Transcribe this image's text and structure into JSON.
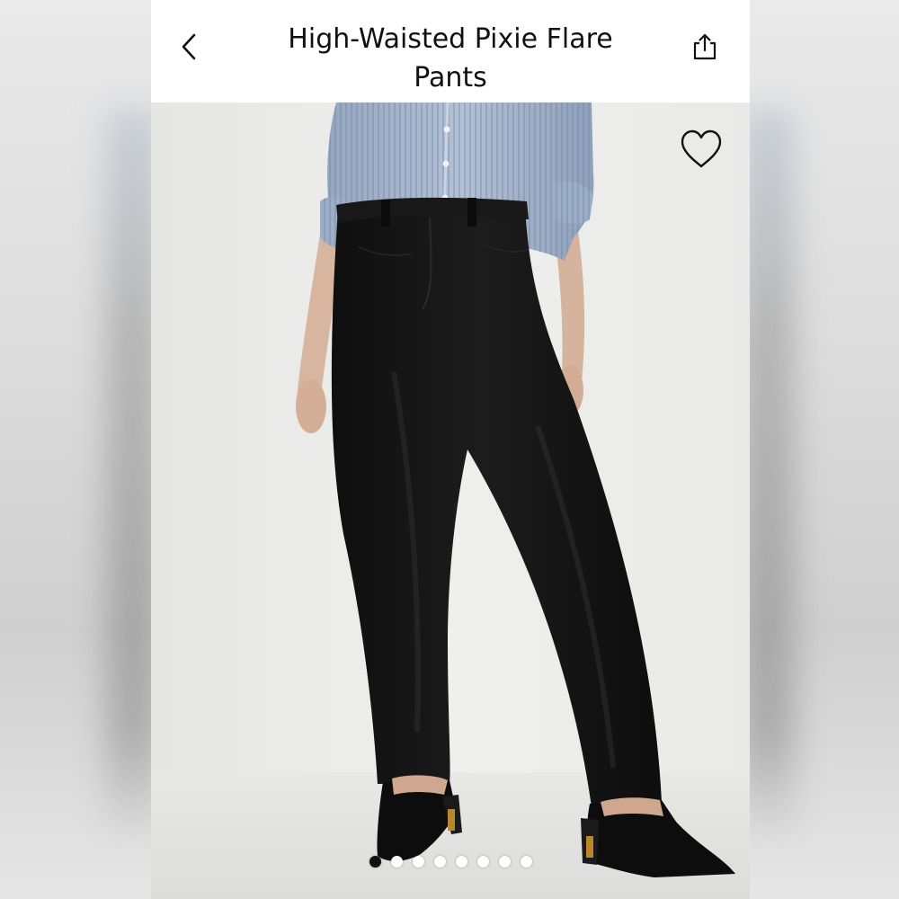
{
  "header": {
    "title": "High-Waisted Pixie Flare Pants",
    "back_icon": "chevron-left-icon",
    "share_icon": "share-icon"
  },
  "product_image": {
    "favorite_icon": "heart-outline-icon"
  },
  "carousel": {
    "total": 8,
    "active_index": 0,
    "dots": [
      {
        "active": true
      },
      {
        "active": false
      },
      {
        "active": false
      },
      {
        "active": false
      },
      {
        "active": false
      },
      {
        "active": false
      },
      {
        "active": false
      },
      {
        "active": false
      }
    ]
  },
  "colors": {
    "header_bg": "#ffffff",
    "text": "#111111",
    "photo_bg": "#ececea",
    "pants": "#141414",
    "shirt": "#a9b7cc"
  }
}
